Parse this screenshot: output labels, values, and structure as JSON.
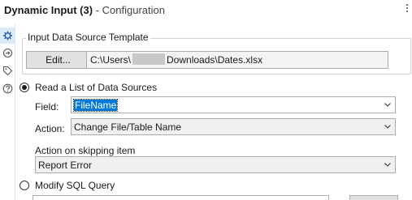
{
  "window": {
    "title_bold": "Dynamic Input (3)",
    "title_rest": " - Configuration"
  },
  "sidebar": {
    "icons": [
      "gear-icon",
      "connection-icon",
      "tag-icon",
      "help-icon"
    ]
  },
  "template": {
    "group_title": "Input Data Source Template",
    "edit_label": "Edit...",
    "path_prefix": "C:\\Users\\",
    "path_suffix": "Downloads\\Dates.xlsx"
  },
  "mode_read_list": {
    "label": "Read a List of Data Sources",
    "checked": true,
    "field_label": "Field:",
    "field_value": "FileName",
    "action_label": "Action:",
    "action_value": "Change File/Table Name",
    "skip_label": "Action on skipping item",
    "skip_value": "Report Error"
  },
  "mode_sql": {
    "label": "Modify SQL Query",
    "checked": false
  }
}
